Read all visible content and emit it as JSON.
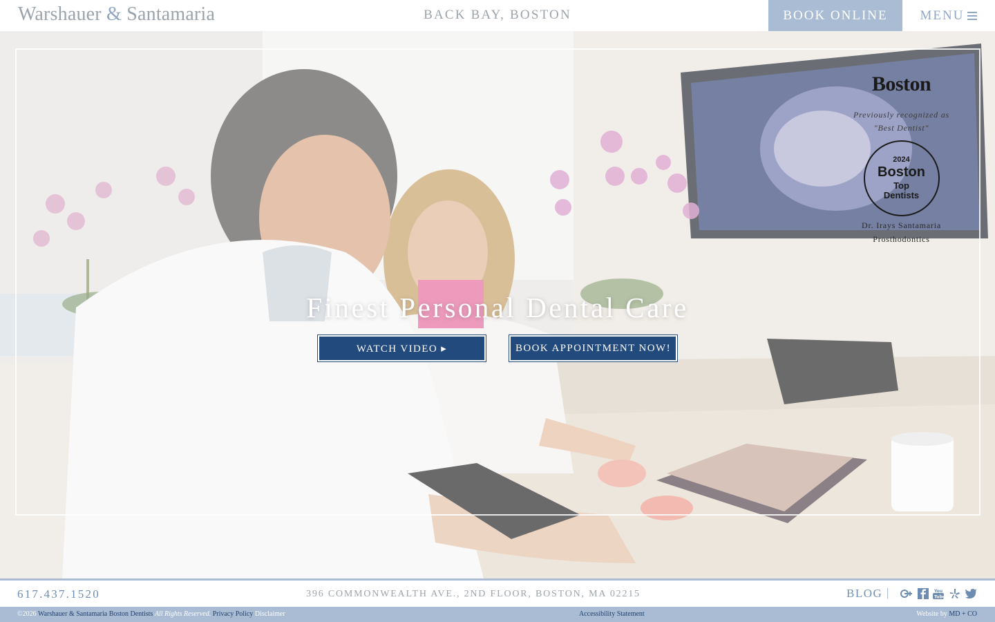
{
  "header": {
    "logo_left": "Warshauer",
    "logo_amp": "&",
    "logo_right": "Santamaria",
    "location": "BACK BAY, BOSTON",
    "book_online": "BOOK ONLINE",
    "menu": "MENU"
  },
  "hero": {
    "title": "Finest Personal Dental Care",
    "watch_video": "WATCH VIDEO ▸",
    "book_appointment": "BOOK APPOINTMENT NOW!",
    "recognition": {
      "magazine": "Boston",
      "previously_line1": "Previously recognized as",
      "previously_line2": "\"Best Dentist\"",
      "badge_year": "2024",
      "badge_magazine": "Boston",
      "badge_line1": "Top",
      "badge_line2": "Dentists",
      "doctor_name": "Dr. Irays Santamaria",
      "doctor_specialty": "Prosthodontics"
    }
  },
  "infobar": {
    "phone": "617.437.1520",
    "address": "396 COMMONWEALTH AVE., 2ND FLOOR, BOSTON, MA 02215",
    "blog": "BLOG",
    "separator": "|",
    "social_icons": [
      "google-plus-icon",
      "facebook-icon",
      "youtube-icon",
      "yelp-icon",
      "twitter-icon"
    ]
  },
  "footer": {
    "copyright": "©2026",
    "practice_link": "Warshauer & Santamaria Boston Dentists",
    "rights": "All Rights Reserved.",
    "privacy": "Privacy Policy",
    "disclaimer": "Disclaimer",
    "accessibility": "Accessibility Statement",
    "website_by": "Website by",
    "agency": "MD + CO"
  },
  "colors": {
    "accent_light": "#a9bcd4",
    "accent_blue": "#6d8cb2",
    "button_navy": "#234a7c",
    "logo_gray": "#9aa3ab"
  }
}
